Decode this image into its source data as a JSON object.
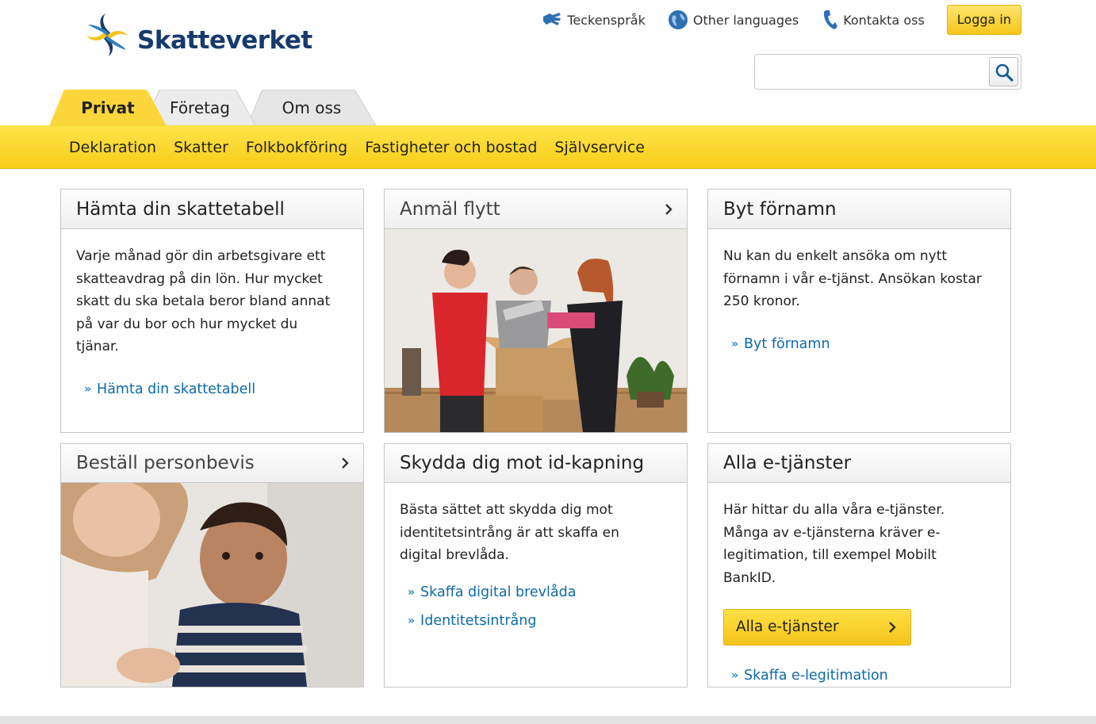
{
  "header": {
    "logo_text": "Skatteverket",
    "links": [
      {
        "label": "Teckenspråk",
        "icon": "sign-language-icon"
      },
      {
        "label": "Other languages",
        "icon": "globe-icon"
      },
      {
        "label": "Kontakta oss",
        "icon": "phone-icon"
      }
    ],
    "login_label": "Logga in",
    "search_placeholder": ""
  },
  "tabs": [
    {
      "label": "Privat",
      "active": true
    },
    {
      "label": "Företag",
      "active": false
    },
    {
      "label": "Om oss",
      "active": false
    }
  ],
  "subnav": [
    "Deklaration",
    "Skatter",
    "Folkbokföring",
    "Fastigheter och bostad",
    "Självservice"
  ],
  "cards": {
    "skattetabell": {
      "title": "Hämta din skattetabell",
      "text": "Varje månad gör din arbetsgivare ett skatteavdrag på din lön. Hur mycket skatt du ska betala beror bland annat på var du bor och hur mycket du tjänar.",
      "link": "Hämta din skattetabell"
    },
    "flytt": {
      "title": "Anmäl flytt"
    },
    "fornamn": {
      "title": "Byt förnamn",
      "text": "Nu kan du enkelt ansöka om nytt förnamn i vår e-tjänst. Ansökan kostar 250 kronor.",
      "link": "Byt förnamn"
    },
    "personbevis": {
      "title": "Beställ personbevis"
    },
    "idkapning": {
      "title": "Skydda dig mot id-kapning",
      "text": "Bästa sättet att skydda dig mot identitetsintrång är att skaffa en digital brevlåda.",
      "links": [
        "Skaffa digital brevlåda",
        "Identitetsintrång"
      ]
    },
    "etjanster": {
      "title": "Alla e-tjänster",
      "text": "Här hittar du alla våra e-tjänster. Många av e-tjänsterna kräver e-legitimation, till exempel Mobilt BankID.",
      "button": "Alla e-tjänster",
      "link": "Skaffa e-legitimation"
    }
  },
  "colors": {
    "brand_blue": "#163a6d",
    "brand_yellow": "#f9cd18",
    "link_blue": "#0d6aa8"
  }
}
